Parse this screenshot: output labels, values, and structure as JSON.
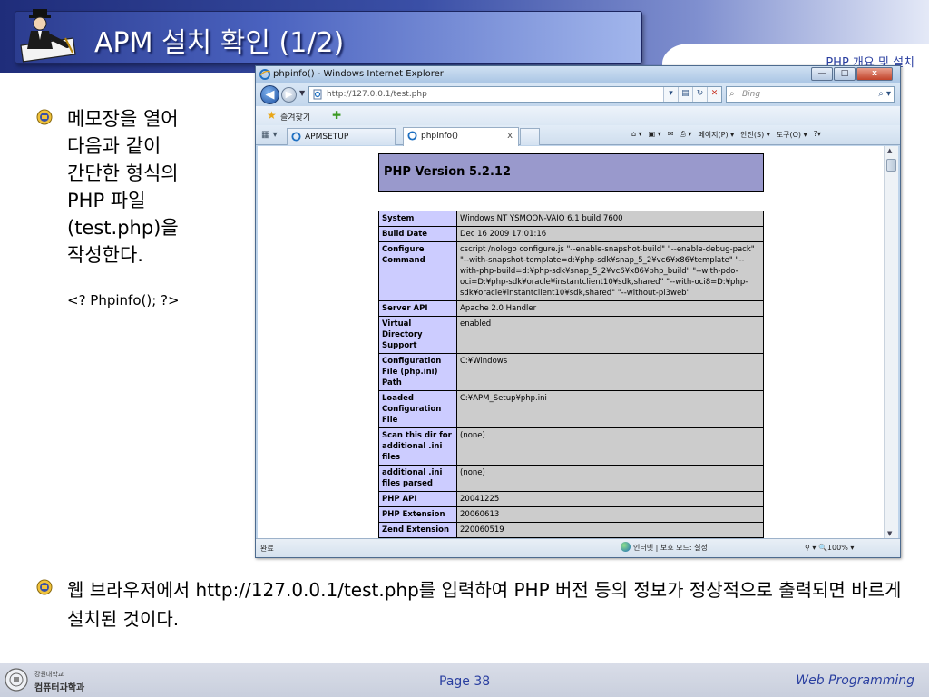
{
  "slide": {
    "title": "APM 설치 확인 (1/2)",
    "subtitle": "PHP 개요 및 설치",
    "bullet1_text": "메모장을 열어\n다음과 같이\n간단한 형식의\nPHP 파일\n(test.php)을\n작성한다.",
    "code": "<? Phpinfo(); ?>",
    "bullet2_text": "웹 브라우저에서 http://127.0.0.1/test.php를 입력하여 PHP 버전 등의 정보가 정상적으로 출력되면 바르게 설치된 것이다."
  },
  "browser": {
    "window_title": "phpinfo() - Windows Internet Explorer",
    "window_buttons": {
      "minimize": "—",
      "maximize": "□",
      "close": "x"
    },
    "address": "http://127.0.0.1/test.php",
    "search_placeholder": "Bing",
    "favorites_label": "즐겨찾기",
    "tabs": [
      {
        "label": "APMSETUP"
      },
      {
        "label": "phpinfo()"
      }
    ],
    "commands": [
      "페이지(P) ▾",
      "안전(S) ▾",
      "도구(O) ▾",
      "?▾"
    ],
    "status_left": "완료",
    "status_zone": "인터넷 | 보호 모드: 설정",
    "status_zoom": "100%"
  },
  "phpinfo": {
    "version": "PHP Version 5.2.12",
    "rows": [
      {
        "key": "System",
        "value": "Windows NT YSMOON-VAIO 6.1 build 7600"
      },
      {
        "key": "Build Date",
        "value": "Dec 16 2009 17:01:16"
      },
      {
        "key": "Configure Command",
        "value": "cscript /nologo configure.js \"--enable-snapshot-build\" \"--enable-debug-pack\" \"--with-snapshot-template=d:¥php-sdk¥snap_5_2¥vc6¥x86¥template\" \"--with-php-build=d:¥php-sdk¥snap_5_2¥vc6¥x86¥php_build\" \"--with-pdo-oci=D:¥php-sdk¥oracle¥instantclient10¥sdk,shared\" \"--with-oci8=D:¥php-sdk¥oracle¥instantclient10¥sdk,shared\" \"--without-pi3web\""
      },
      {
        "key": "Server API",
        "value": "Apache 2.0 Handler"
      },
      {
        "key": "Virtual Directory Support",
        "value": "enabled"
      },
      {
        "key": "Configuration File (php.ini) Path",
        "value": "C:¥Windows"
      },
      {
        "key": "Loaded Configuration File",
        "value": "C:¥APM_Setup¥php.ini"
      },
      {
        "key": "Scan this dir for additional .ini files",
        "value": "(none)"
      },
      {
        "key": "additional .ini files parsed",
        "value": "(none)"
      },
      {
        "key": "PHP API",
        "value": "20041225"
      },
      {
        "key": "PHP Extension",
        "value": "20060613"
      },
      {
        "key": "Zend Extension",
        "value": "220060519"
      }
    ]
  },
  "footer": {
    "university": "강원대학교",
    "department": "컴퓨터과학과",
    "page": "Page 38",
    "course": "Web Programming"
  },
  "colors": {
    "header_dark": "#1f2d7a",
    "accent_text": "#2a3fa0",
    "php_header": "#9999cc",
    "php_key": "#ccccff",
    "php_value": "#cccccc"
  }
}
